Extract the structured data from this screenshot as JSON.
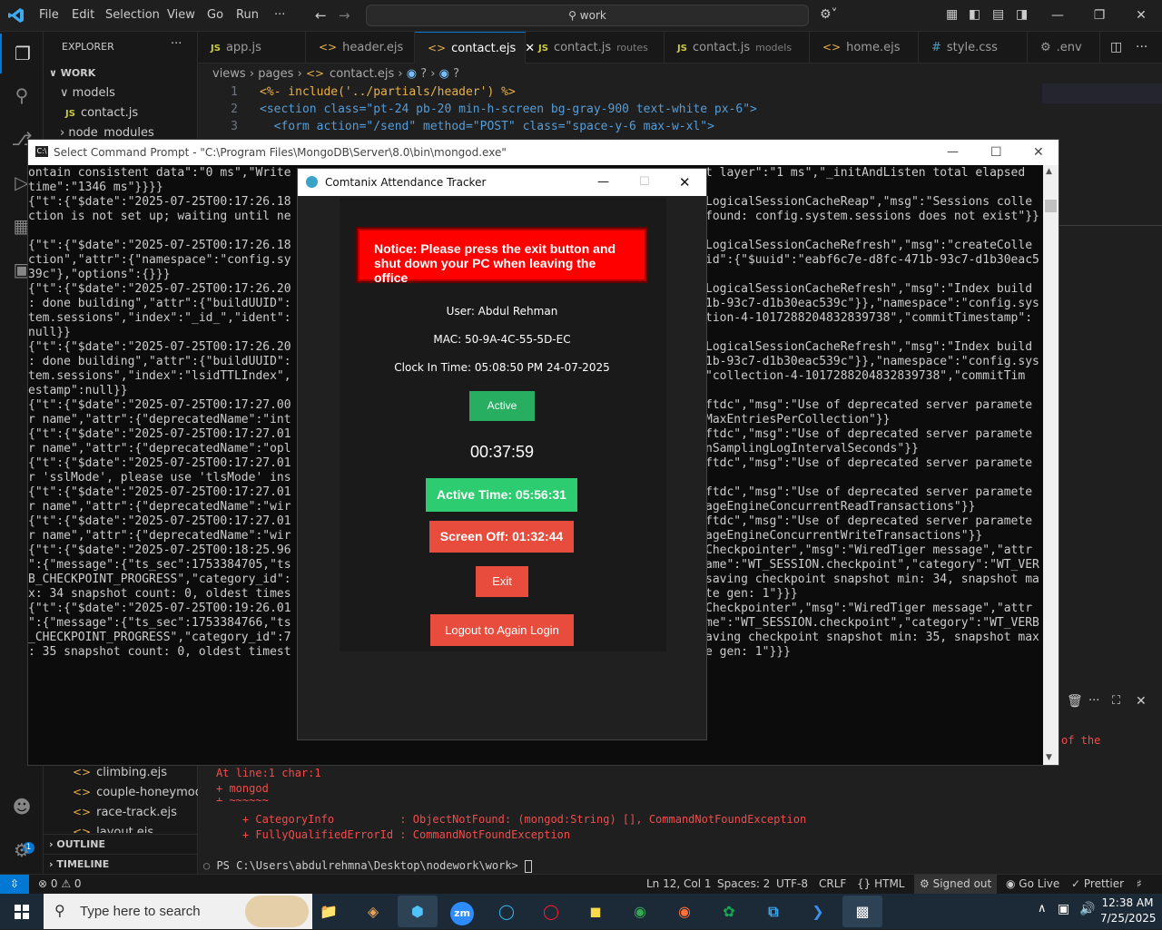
{
  "vscode": {
    "menu": [
      "File",
      "Edit",
      "Selection",
      "View",
      "Go",
      "Run",
      "···"
    ],
    "search_text": "work",
    "sidebar": {
      "header": "EXPLORER",
      "root": "WORK",
      "models": "models",
      "contact_js": "contact.js",
      "node_modules": "node_modules",
      "files_bottom": [
        "climbing.ejs",
        "couple-honeymoo...",
        "race-track.ejs",
        "layout.ejs"
      ],
      "outline": "OUTLINE",
      "timeline": "TIMELINE"
    },
    "tabs": [
      {
        "label": "app.js",
        "sub": ""
      },
      {
        "label": "header.ejs",
        "sub": ""
      },
      {
        "label": "contact.ejs",
        "sub": ""
      },
      {
        "label": "contact.js",
        "sub": "routes"
      },
      {
        "label": "contact.js",
        "sub": "models"
      },
      {
        "label": "home.ejs",
        "sub": ""
      },
      {
        "label": "style.css",
        "sub": ""
      },
      {
        "label": ".env",
        "sub": ""
      }
    ],
    "breadcrumb": [
      "views",
      "pages",
      "contact.ejs",
      "?",
      "?"
    ],
    "code": [
      {
        "n": "1",
        "text": "<%- include('../partials/header') %>"
      },
      {
        "n": "2",
        "text": "<section class=\"pt-24 pb-20 min-h-screen bg-gray-900 text-white px-6\">"
      },
      {
        "n": "3",
        "text": "  <form action=\"/send\" method=\"POST\" class=\"space-y-6 max-w-xl\">"
      },
      {
        "n": "4",
        "text": ""
      }
    ],
    "terminal": {
      "line1": "At line:1 char:1",
      "line2": "+ mongod",
      "line3": "+ ~~~~~~",
      "line4": "    + CategoryInfo          : ObjectNotFound: (mongod:String) [], CommandNotFoundException",
      "line5": "    + FullyQualifiedErrorId : CommandNotFoundException",
      "prompt": "PS C:\\Users\\abdulrehmna\\Desktop\\nodework\\work> ",
      "side_text": "of the"
    },
    "status": {
      "errors": "0",
      "warnings": "0",
      "position": "Ln 12, Col 1",
      "spaces": "Spaces: 2",
      "encoding": "UTF-8",
      "eol": "CRLF",
      "language": "HTML",
      "account": "Signed out",
      "golive": "Go Live",
      "prettier": "Prettier"
    }
  },
  "cmd": {
    "title": "Select Command Prompt - \"C:\\Program Files\\MongoDB\\Server\\8.0\\bin\\mongod.exe\"",
    "lines": [
      {
        "l": "ontain consistent data\":\"0 ms\",\"Write",
        "r": "t layer\":\"1 ms\",\"_initAndListen total elapsed"
      },
      {
        "l": "time\":\"1346 ms\"}}}}",
        "r": ""
      },
      {
        "l": "{\"t\":{\"$date\":\"2025-07-25T00:17:26.18",
        "r": "LogicalSessionCacheReap\",\"msg\":\"Sessions colle"
      },
      {
        "l": "ction is not set up; waiting until ne",
        "r": "found: config.system.sessions does not exist\"}}"
      },
      {
        "l": "",
        "r": ""
      },
      {
        "l": "{\"t\":{\"$date\":\"2025-07-25T00:17:26.18",
        "r": "LogicalSessionCacheRefresh\",\"msg\":\"createColle"
      },
      {
        "l": "ction\",\"attr\":{\"namespace\":\"config.sy",
        "r": "id\":{\"$uuid\":\"eabf6c7e-d8fc-471b-93c7-d1b30eac5"
      },
      {
        "l": "39c\"},\"options\":{}}}",
        "r": ""
      },
      {
        "l": "{\"t\":{\"$date\":\"2025-07-25T00:17:26.20",
        "r": "LogicalSessionCacheRefresh\",\"msg\":\"Index build"
      },
      {
        "l": ": done building\",\"attr\":{\"buildUUID\":",
        "r": "1b-93c7-d1b30eac539c\"}},\"namespace\":\"config.sys"
      },
      {
        "l": "tem.sessions\",\"index\":\"_id_\",\"ident\":",
        "r": "tion-4-1017288204832839738\",\"commitTimestamp\":"
      },
      {
        "l": "null}}",
        "r": ""
      },
      {
        "l": "{\"t\":{\"$date\":\"2025-07-25T00:17:26.20",
        "r": "LogicalSessionCacheRefresh\",\"msg\":\"Index build"
      },
      {
        "l": ": done building\",\"attr\":{\"buildUUID\":",
        "r": "1b-93c7-d1b30eac539c\"}},\"namespace\":\"config.sys"
      },
      {
        "l": "tem.sessions\",\"index\":\"lsidTTLIndex\",",
        "r": "\"collection-4-1017288204832839738\",\"commitTim"
      },
      {
        "l": "estamp\":null}}",
        "r": ""
      },
      {
        "l": "{\"t\":{\"$date\":\"2025-07-25T00:17:27.00",
        "r": "ftdc\",\"msg\":\"Use of deprecated server paramete"
      },
      {
        "l": "r name\",\"attr\":{\"deprecatedName\":\"int",
        "r": "MaxEntriesPerCollection\"}}"
      },
      {
        "l": "{\"t\":{\"$date\":\"2025-07-25T00:17:27.01",
        "r": "ftdc\",\"msg\":\"Use of deprecated server paramete"
      },
      {
        "l": "r name\",\"attr\":{\"deprecatedName\":\"opl",
        "r": "nSamplingLogIntervalSeconds\"}}"
      },
      {
        "l": "{\"t\":{\"$date\":\"2025-07-25T00:17:27.01",
        "r": "ftdc\",\"msg\":\"Use of deprecated server paramete"
      },
      {
        "l": "r 'sslMode', please use 'tlsMode' ins",
        "r": ""
      },
      {
        "l": "{\"t\":{\"$date\":\"2025-07-25T00:17:27.01",
        "r": "ftdc\",\"msg\":\"Use of deprecated server paramete"
      },
      {
        "l": "r name\",\"attr\":{\"deprecatedName\":\"wir",
        "r": "ageEngineConcurrentReadTransactions\"}}"
      },
      {
        "l": "{\"t\":{\"$date\":\"2025-07-25T00:17:27.01",
        "r": "ftdc\",\"msg\":\"Use of deprecated server paramete"
      },
      {
        "l": "r name\",\"attr\":{\"deprecatedName\":\"wir",
        "r": "ageEngineConcurrentWriteTransactions\"}}"
      },
      {
        "l": "{\"t\":{\"$date\":\"2025-07-25T00:18:25.96",
        "r": "Checkpointer\",\"msg\":\"WiredTiger message\",\"attr"
      },
      {
        "l": "\":{\"message\":{\"ts_sec\":1753384705,\"ts",
        "r": "ame\":\"WT_SESSION.checkpoint\",\"category\":\"WT_VER"
      },
      {
        "l": "B_CHECKPOINT_PROGRESS\",\"category_id\":",
        "r": "saving checkpoint snapshot min: 34, snapshot ma"
      },
      {
        "l": "x: 34 snapshot count: 0, oldest times",
        "r": "te gen: 1\"}}}"
      },
      {
        "l": "{\"t\":{\"$date\":\"2025-07-25T00:19:26.01",
        "r": "Checkpointer\",\"msg\":\"WiredTiger message\",\"attr"
      },
      {
        "l": "\":{\"message\":{\"ts_sec\":1753384766,\"ts",
        "r": "me\":\"WT_SESSION.checkpoint\",\"category\":\"WT_VERB"
      },
      {
        "l": "_CHECKPOINT_PROGRESS\",\"category_id\":7",
        "r": "aving checkpoint snapshot min: 35, snapshot max"
      },
      {
        "l": ": 35 snapshot count: 0, oldest timest",
        "r": "e gen: 1\"}}}"
      }
    ]
  },
  "tracker": {
    "title": "Comtanix Attendance Tracker",
    "notice": "Notice: Please press the exit button and shut down your PC when leaving the office",
    "user": "User: Abdul Rehman",
    "mac": "MAC: 50-9A-4C-55-5D-EC",
    "clock_in": "Clock In Time: 05:08:50 PM 24-07-2025",
    "status": "Active",
    "timer": "00:37:59",
    "active_time": "Active Time: 05:56:31",
    "screen_off": "Screen Off: 01:32:44",
    "exit": "Exit",
    "logout": "Logout to Again Login"
  },
  "taskbar": {
    "search_placeholder": "Type here to search",
    "time": "12:38 AM",
    "date": "7/25/2025"
  },
  "colors": {
    "vscode_accent": "#0078d4",
    "tracker_notice_red": "#ff0000",
    "tracker_green": "#2ecc71",
    "tracker_red": "#e74c3c"
  }
}
